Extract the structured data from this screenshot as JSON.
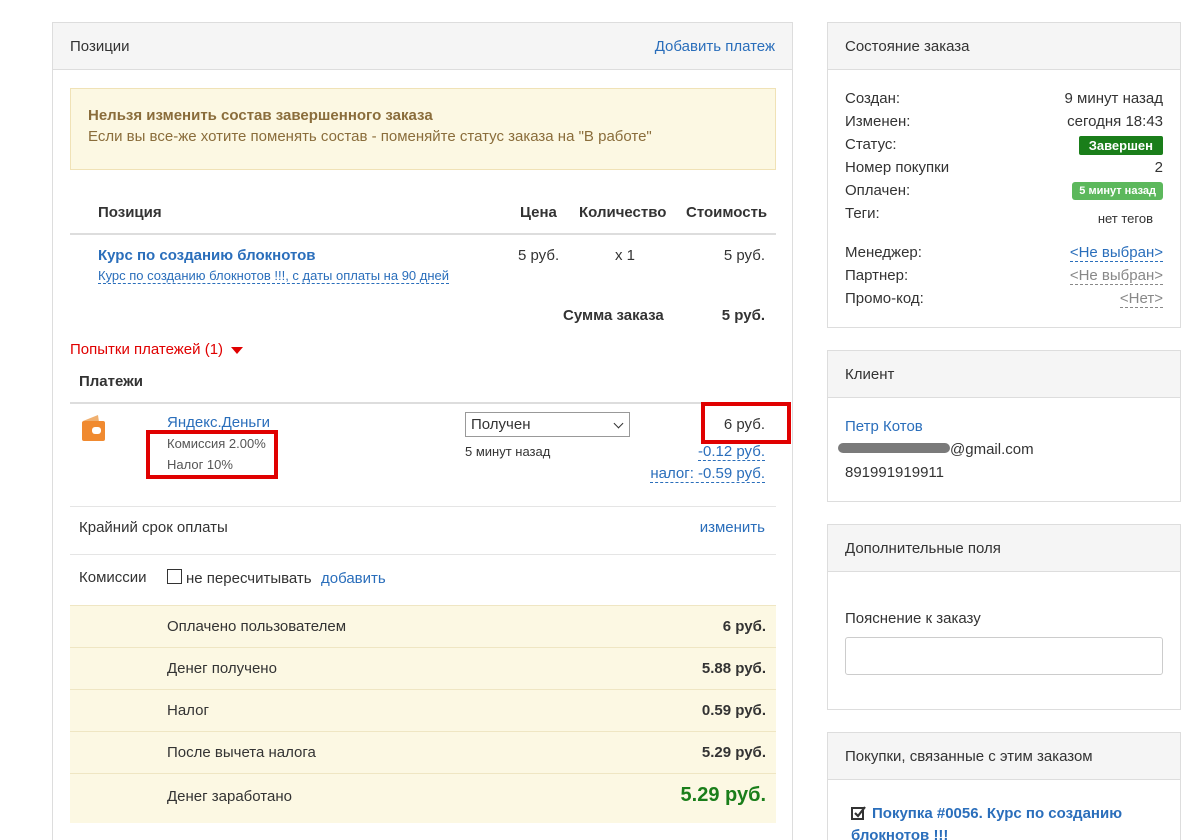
{
  "positions_panel": {
    "title": "Позиции",
    "add_payment_link": "Добавить платеж",
    "warning_title": "Нельзя изменить состав завершенного заказа",
    "warning_text": "Если вы все-же хотите поменять состав - поменяйте статус заказа на \"В работе\"",
    "table_headers": {
      "position": "Позиция",
      "price": "Цена",
      "quantity": "Количество",
      "cost": "Стоимость"
    },
    "item": {
      "name": "Курс по созданию блокнотов",
      "offer": "Курс по созданию блокнотов !!!, с даты оплаты на 90 дней",
      "price": "5 руб.",
      "quantity": "x 1",
      "cost": "5 руб."
    },
    "order_sum_label": "Сумма заказа",
    "order_sum_value": "5 руб.",
    "payment_attempts": "Попытки платежей (1)",
    "payments_title": "Платежи",
    "payment": {
      "method": "Яндекс.Деньги",
      "commission": "Комиссия 2.00%",
      "tax": "Налог 10%",
      "status": "Получен",
      "time": "5 минут назад",
      "amount": "6 руб.",
      "fee": "-0.12 руб.",
      "tax_amount": "налог: -0.59 руб."
    },
    "deadline_label": "Крайний срок оплаты",
    "deadline_change": "изменить",
    "commissions_label": "Комиссии",
    "no_recalc_label": "не пересчитывать",
    "add_link": "добавить",
    "summary": [
      {
        "label": "Оплачено пользователем",
        "value": "6 руб."
      },
      {
        "label": "Денег получено",
        "value": "5.88 руб."
      },
      {
        "label": "Налог",
        "value": "0.59 руб."
      },
      {
        "label": "После вычета налога",
        "value": "5.29 руб."
      },
      {
        "label": "Денег заработано",
        "value": "5.29 руб."
      }
    ]
  },
  "order_state": {
    "title": "Состояние заказа",
    "created_label": "Создан:",
    "created_value": "9 минут назад",
    "changed_label": "Изменен:",
    "changed_value": "сегодня 18:43",
    "status_label": "Статус:",
    "status_value": "Завершен",
    "purchase_no_label": "Номер покупки",
    "purchase_no_value": "2",
    "paid_label": "Оплачен:",
    "paid_value": "5 минут назад",
    "tags_label": "Теги:",
    "tags_value": "нет тегов",
    "manager_label": "Менеджер:",
    "manager_value": "<Не выбран>",
    "partner_label": "Партнер:",
    "partner_value": "<Не выбран>",
    "promo_label": "Промо-код:",
    "promo_value": "<Нет>"
  },
  "client": {
    "title": "Клиент",
    "name": "Петр Котов",
    "email_suffix": "@gmail.com",
    "phone": "891991919911"
  },
  "extra_fields": {
    "title": "Дополнительные поля",
    "comment_label": "Пояснение к заказу",
    "comment_value": ""
  },
  "related": {
    "title": "Покупки, связанные с этим заказом",
    "purchase_line1": "Покупка #0056. Курс по созданию",
    "purchase_line2": "блокнотов !!!"
  },
  "colors": {
    "link": "#2a6ebb",
    "status_badge": "#1a7e1a",
    "paid_badge": "#5cb85c",
    "warning_bg": "#fcf8e3",
    "highlight": "#e00000",
    "earned": "#1a7e1a"
  }
}
